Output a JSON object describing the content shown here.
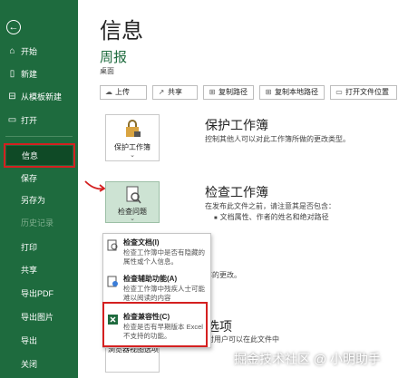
{
  "sidebar": {
    "back_icon": "back-arrow-icon",
    "items": [
      {
        "label": "开始",
        "icon": "home-icon"
      },
      {
        "label": "新建",
        "icon": "new-file-icon"
      },
      {
        "label": "从模板新建",
        "icon": "template-icon"
      },
      {
        "label": "打开",
        "icon": "folder-icon"
      },
      {
        "label": "信息"
      },
      {
        "label": "保存"
      },
      {
        "label": "另存为"
      },
      {
        "label": "历史记录"
      },
      {
        "label": "打印"
      },
      {
        "label": "共享"
      },
      {
        "label": "导出PDF"
      },
      {
        "label": "导出图片"
      },
      {
        "label": "导出"
      },
      {
        "label": "关闭"
      }
    ]
  },
  "main": {
    "title": "信息",
    "doc_name": "周报",
    "doc_location": "桌面",
    "toolbar": [
      {
        "label": "上传",
        "icon": "upload-icon"
      },
      {
        "label": "共享",
        "icon": "share-icon"
      },
      {
        "label": "复制路径",
        "icon": "link-icon"
      },
      {
        "label": "复制本地路径",
        "icon": "link-icon"
      },
      {
        "label": "打开文件位置",
        "icon": "folder-icon"
      }
    ],
    "protect": {
      "button_label": "保护工作簿",
      "title": "保护工作簿",
      "desc": "控制其他人可以对此工作簿所做的更改类型。"
    },
    "inspect": {
      "button_label": "检查问题",
      "title": "检查工作簿",
      "desc": "在发布此文件之前，请注意其是否包含：",
      "bullet": "文档属性、作者的姓名和绝对路径",
      "partial_desc": "存的更改。",
      "partial_title": "选项",
      "partial_desc2": "时用户可以在此文件中",
      "browser_view_label": "浏览器视图选项"
    },
    "dropdown": [
      {
        "title": "检查文档(I)",
        "desc": "检查工作簿中是否有隐藏的属性或个人信息。"
      },
      {
        "title": "检查辅助功能(A)",
        "desc": "检查工作簿中残疾人士可能难以阅读的内容"
      },
      {
        "title": "检查兼容性(C)",
        "desc": "检查是否有早期版本 Excel 不支持的功能。"
      }
    ]
  },
  "watermark": "掘金技术社区 @ 小明助手",
  "colors": {
    "sidebar": "#1e6b3e",
    "selected": "#0f4a26",
    "highlight": "#d42020"
  }
}
